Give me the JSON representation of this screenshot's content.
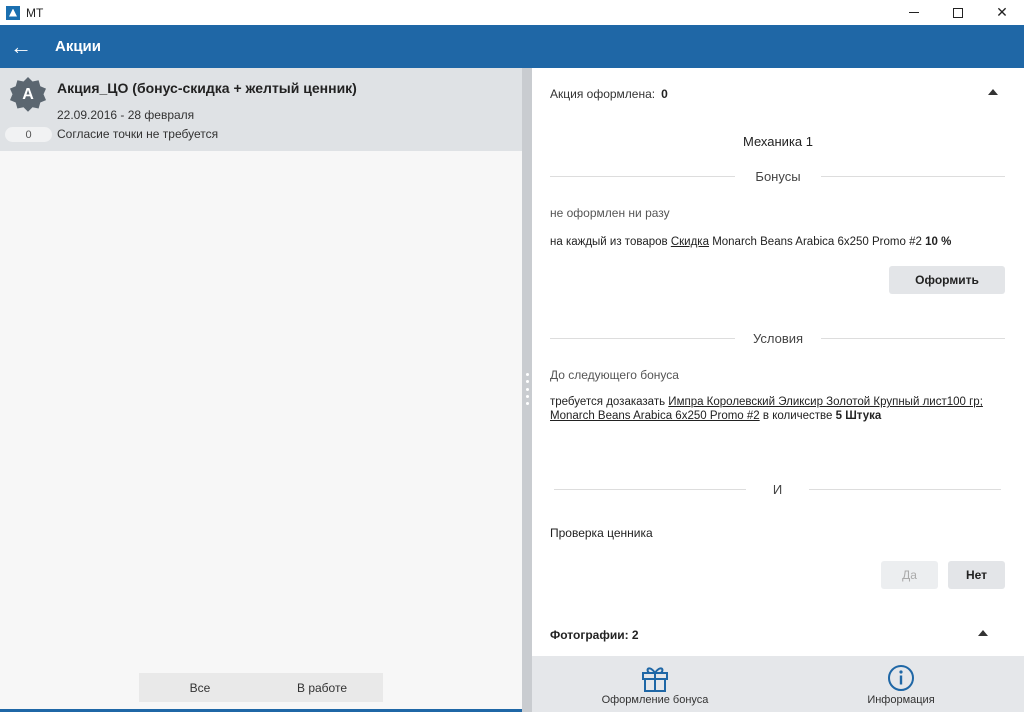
{
  "window": {
    "title": "МТ",
    "controls": {
      "minimize": "",
      "maximize": "",
      "close": "✕"
    }
  },
  "appbar": {
    "back_icon": "←",
    "title": "Акции"
  },
  "promo": {
    "badge_letter": "A",
    "title": "Акция_ЦО (бонус-скидка + желтый ценник)",
    "dates": "22.09.2016 - 28 февраля",
    "counter": "0",
    "consent": "Согласие точки не требуется"
  },
  "filters": {
    "all": "Все",
    "in_work": "В работе"
  },
  "details": {
    "registered_label": "Акция оформлена:",
    "registered_value": "0",
    "mechanics_title": "Механика 1",
    "bonuses_title": "Бонусы",
    "bonus_status": "не оформлен ни разу",
    "bonus_text_prefix": "на каждый из товаров",
    "bonus_link": "Скидка",
    "bonus_product": "Monarch Beans Arabica 6x250 Promo #2",
    "bonus_percent": "10 %",
    "apply_button": "Оформить",
    "conditions_title": "Условия",
    "next_bonus_label": "До следующего бонуса",
    "condition_prefix": "требуется дозаказать",
    "condition_link": "Импра Королевский Эликсир Золотой Крупный лист100 гр; Monarch Beans Arabica 6x250 Promo #2",
    "condition_mid": "в количестве",
    "condition_qty": "5 Штука",
    "and_label": "И",
    "price_check_label": "Проверка ценника",
    "yes_button": "Да",
    "no_button": "Нет",
    "photos_label": "Фотографии:",
    "photos_value": "2"
  },
  "bottom_nav": {
    "bonus": {
      "icon": "gift-icon",
      "label": "Оформление бонуса"
    },
    "info": {
      "icon": "info-icon",
      "label": "Информация"
    }
  },
  "colors": {
    "accent": "#1f67a6",
    "badge": "#5b6670",
    "card_bg": "#dfe2e5"
  }
}
